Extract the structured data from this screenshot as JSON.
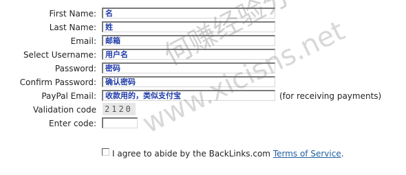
{
  "form": {
    "rows": [
      {
        "label": "First Name:",
        "value": "名"
      },
      {
        "label": "Last Name:",
        "value": "姓"
      },
      {
        "label": "Email:",
        "value": "邮箱"
      },
      {
        "label": "Select Username:",
        "value": "用户名"
      },
      {
        "label": "Password:",
        "value": "密码"
      },
      {
        "label": "Confirm Password:",
        "value": "确认密码"
      },
      {
        "label": "PayPal Email:",
        "value": "收款用的，类似支付宝",
        "hint": "(for receiving payments)"
      }
    ],
    "validation": {
      "label": "Validation code",
      "code": "2120"
    },
    "enter_code": {
      "label": "Enter code:",
      "value": ""
    }
  },
  "terms": {
    "checked": false,
    "text": "I agree to abide by the BackLinks.com ",
    "link": "Terms of Service",
    "suffix": "."
  },
  "watermark": {
    "site_cn": "何赚经验分享",
    "url": "www.xicisns.net"
  },
  "colors": {
    "value_text": "#1f3aa8",
    "link": "#1f5fa0",
    "watermark": "#777777"
  }
}
